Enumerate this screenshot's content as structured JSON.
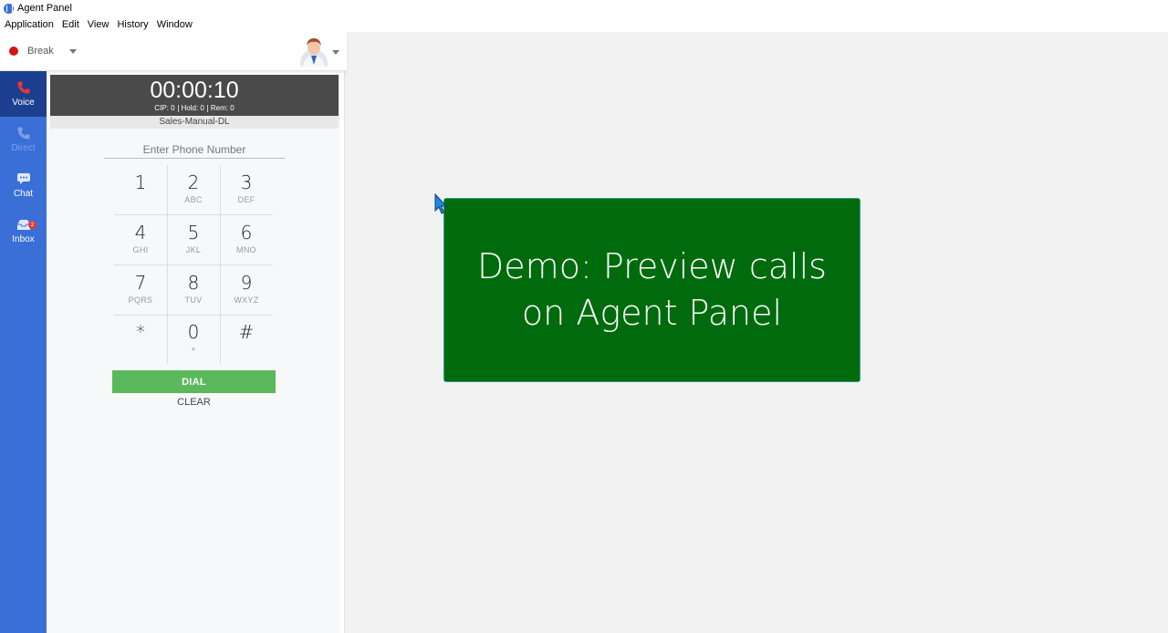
{
  "window": {
    "title": "Agent Panel"
  },
  "menu": [
    "Application",
    "Edit",
    "View",
    "History",
    "Window"
  ],
  "status": {
    "label": "Break",
    "color": "#d01515"
  },
  "nav": [
    {
      "label": "Voice",
      "icon": "phone-icon",
      "active": true
    },
    {
      "label": "Direct",
      "icon": "phone-icon",
      "disabled": true
    },
    {
      "label": "Chat",
      "icon": "chat-icon"
    },
    {
      "label": "Inbox",
      "icon": "inbox-icon",
      "badge": "2"
    }
  ],
  "call": {
    "timer": "00:00:10",
    "cip": "CIP: 0",
    "hold": "Hold: 0",
    "rem": "Rem: 0",
    "campaign": "Sales-Manual-DL"
  },
  "dialer": {
    "placeholder": "Enter Phone Number",
    "keys": [
      {
        "digit": "1",
        "letters": ""
      },
      {
        "digit": "2",
        "letters": "ABC"
      },
      {
        "digit": "3",
        "letters": "DEF"
      },
      {
        "digit": "4",
        "letters": "GHI"
      },
      {
        "digit": "5",
        "letters": "JKL"
      },
      {
        "digit": "6",
        "letters": "MNO"
      },
      {
        "digit": "7",
        "letters": "PQRS"
      },
      {
        "digit": "8",
        "letters": "TUV"
      },
      {
        "digit": "9",
        "letters": "WXYZ"
      },
      {
        "digit": "*",
        "letters": ""
      },
      {
        "digit": "0",
        "letters": "+"
      },
      {
        "digit": "#",
        "letters": ""
      }
    ],
    "dial_label": "DIAL",
    "clear_label": "CLEAR"
  },
  "overlay": {
    "line1": "Demo: Preview calls",
    "line2": "on Agent Panel"
  },
  "colors": {
    "nav_bg": "#3a6fd8",
    "nav_active": "#1d3f8f",
    "dial_button": "#5cb85c",
    "overlay_bg": "#006b0d"
  }
}
